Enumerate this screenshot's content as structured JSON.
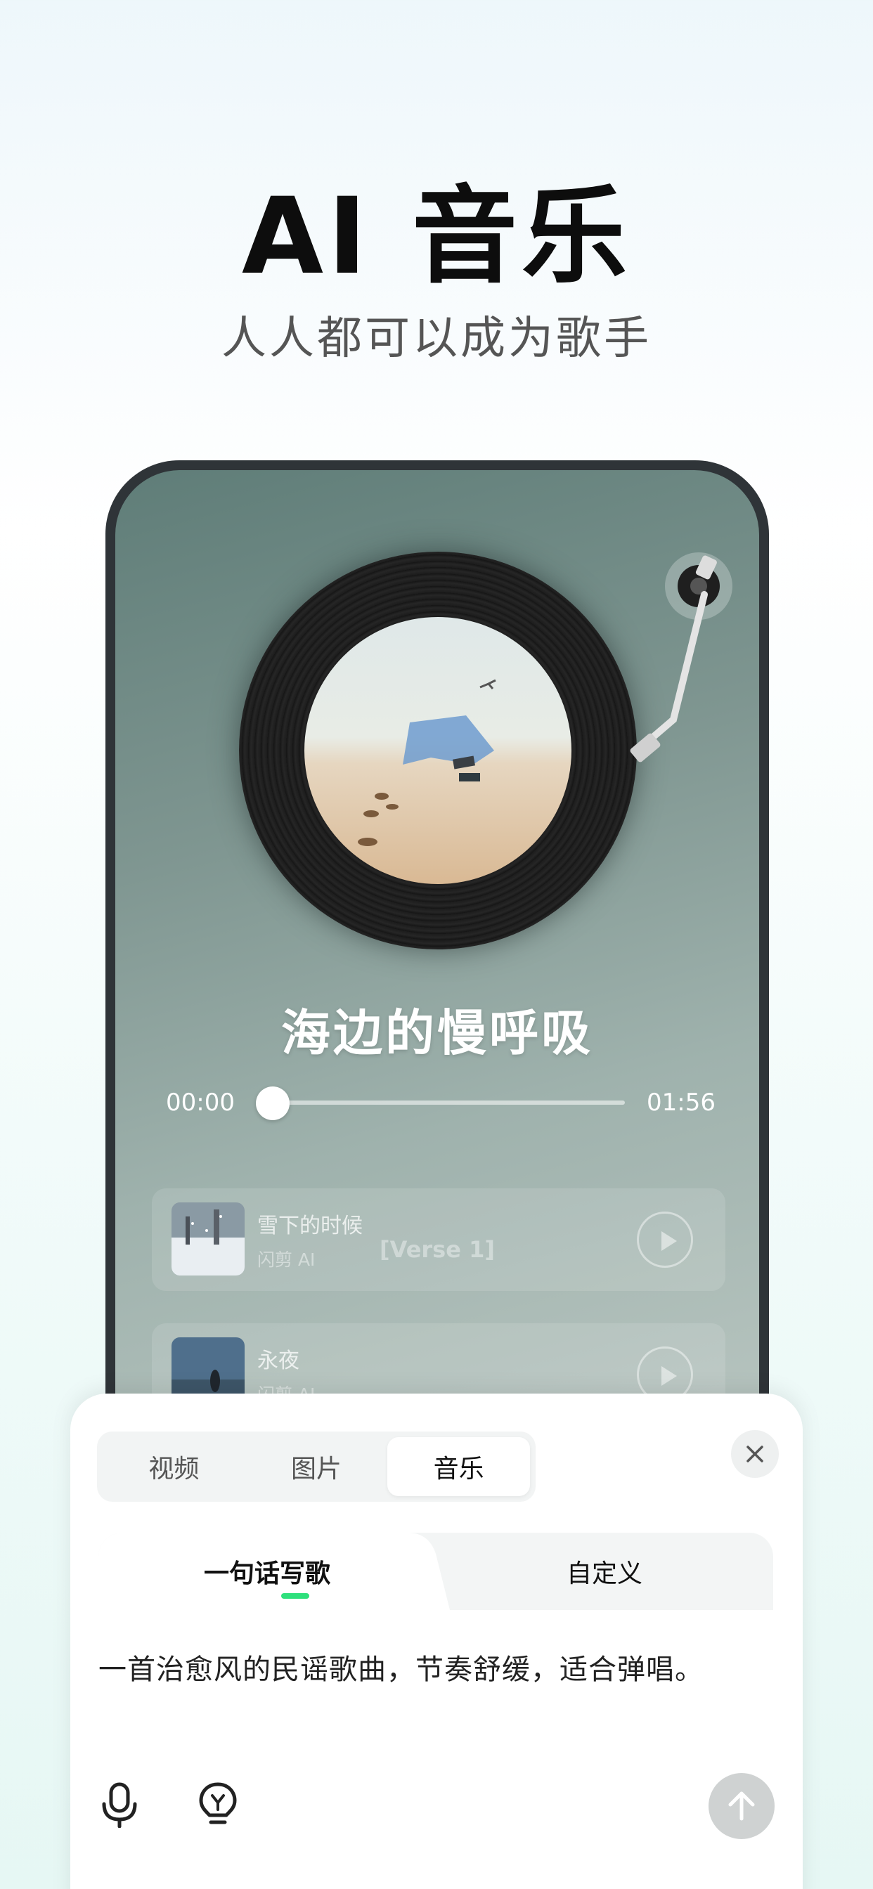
{
  "hero": {
    "title": "AI 音乐",
    "subtitle": "人人都可以成为歌手"
  },
  "player": {
    "song_title": "海边的慢呼吸",
    "time_current": "00:00",
    "time_total": "01:56",
    "progress": 0,
    "lyric_line": "[Verse 1]",
    "tracks": [
      {
        "name": "雪下的时候",
        "artist": "闪剪 AI"
      },
      {
        "name": "永夜",
        "artist": "闪剪 AI"
      }
    ]
  },
  "sheet": {
    "type_tabs": [
      "视频",
      "图片",
      "音乐"
    ],
    "active_type": "音乐",
    "mode_tabs": [
      "一句话写歌",
      "自定义"
    ],
    "active_mode": "一句话写歌",
    "prompt": "一首治愈风的民谣歌曲，节奏舒缓，适合弹唱。",
    "accent_color": "#2ee07c"
  }
}
